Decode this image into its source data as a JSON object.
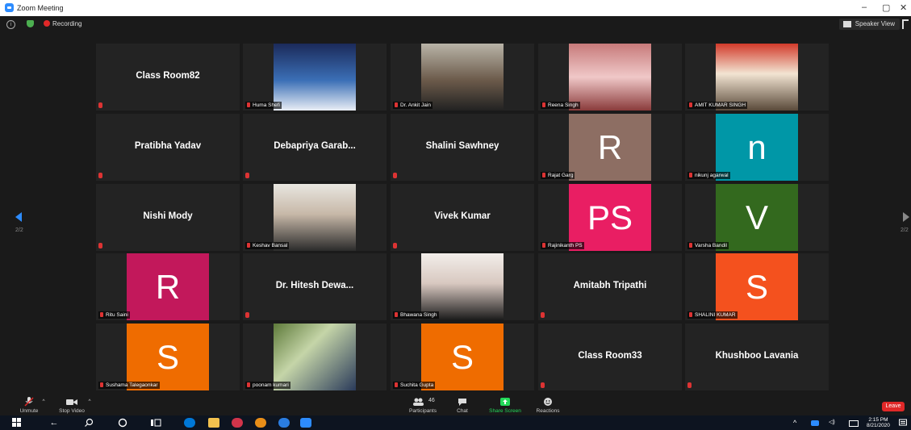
{
  "window": {
    "title": "Zoom Meeting",
    "minimize": "–",
    "maximize": "▢",
    "close": "✕"
  },
  "topbar": {
    "info_icon": "i",
    "recording": "Recording",
    "speaker_view": "Speaker View"
  },
  "pager": {
    "left": "2/2",
    "right": "2/2"
  },
  "tiles": [
    {
      "name": "Class Room82",
      "kind": "name"
    },
    {
      "label": "Huma Shefi",
      "kind": "photo"
    },
    {
      "label": "Dr. Ankit Jain",
      "kind": "photo"
    },
    {
      "label": "Reena Singh",
      "kind": "photo"
    },
    {
      "label": "AMIT KUMAR SINGH",
      "kind": "photo"
    },
    {
      "name": "Pratibha Yadav",
      "kind": "name"
    },
    {
      "name": "Debapriya Garab...",
      "kind": "name"
    },
    {
      "name": "Shalini Sawhney",
      "kind": "name"
    },
    {
      "letter": "R",
      "label": "Rajat Garg",
      "kind": "avatar",
      "color": "#8d6e63"
    },
    {
      "letter": "n",
      "label": "nikunj agarwal",
      "kind": "avatar",
      "color": "#0097a7"
    },
    {
      "name": "Nishi Mody",
      "kind": "name"
    },
    {
      "label": "Keshav Bansal",
      "kind": "photo"
    },
    {
      "name": "Vivek Kumar",
      "kind": "name"
    },
    {
      "letter": "PS",
      "label": "Rajinikanth PS",
      "kind": "avatar",
      "color": "#e91e63"
    },
    {
      "letter": "V",
      "label": "Varsha Bandil",
      "kind": "avatar",
      "color": "#33691e"
    },
    {
      "letter": "R",
      "label": "Ritu Saini",
      "kind": "avatar",
      "color": "#c2185b"
    },
    {
      "name": "Dr. Hitesh Dewa...",
      "kind": "name"
    },
    {
      "label": "Bhawana Singh",
      "kind": "photo"
    },
    {
      "name": "Amitabh Tripathi",
      "kind": "name"
    },
    {
      "letter": "S",
      "label": "SHALINI KUMAR",
      "kind": "avatar",
      "color": "#f4511e"
    },
    {
      "letter": "S",
      "label": "Sushama Talegaonkar",
      "kind": "avatar",
      "color": "#ef6c00"
    },
    {
      "label": "poonam kumari",
      "kind": "photo"
    },
    {
      "letter": "S",
      "label": "Suchita Gupta",
      "kind": "avatar",
      "color": "#ef6c00"
    },
    {
      "name": "Class Room33",
      "kind": "name"
    },
    {
      "name": "Khushboo Lavania",
      "kind": "name"
    }
  ],
  "toolbar": {
    "unmute": "Unmute",
    "stop_video": "Stop Video",
    "participants": "Participants",
    "participants_count": "46",
    "chat": "Chat",
    "share_screen": "Share Screen",
    "reactions": "Reactions",
    "leave": "Leave"
  },
  "taskbar": {
    "time": "2:15 PM",
    "date": "8/21/2020"
  },
  "colors": {
    "accent": "#2d8cff",
    "share_green": "#23d959",
    "leave_red": "#e02828",
    "mute_red": "#dd3333"
  }
}
